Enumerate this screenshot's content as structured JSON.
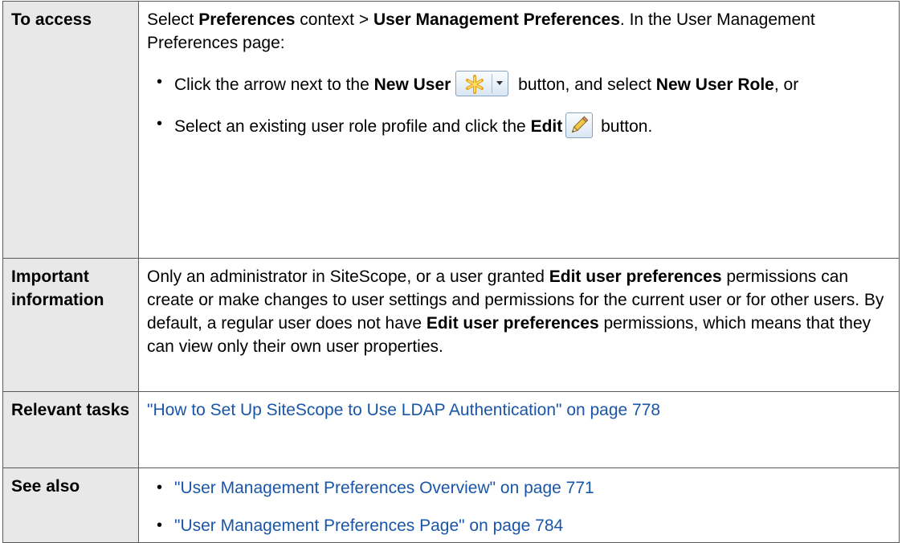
{
  "rows": [
    {
      "header": "To access"
    },
    {
      "header": "Important information"
    },
    {
      "header": "Relevant tasks"
    },
    {
      "header": "See also"
    }
  ],
  "access": {
    "intro": {
      "t1": "Select ",
      "b1": "Preferences",
      "t2": " context > ",
      "b2": "User Management Preferences",
      "t3": ". In the User Management Preferences page:"
    },
    "bullet1": {
      "t1": "Click the arrow next to the ",
      "b1": "New User",
      "t2": " button, and select ",
      "b2": "New User Role",
      "t3": ", or"
    },
    "bullet2": {
      "t1": "Select an existing user role profile and click the ",
      "b1": "Edit",
      "t2": " button."
    }
  },
  "info": {
    "t1": "Only an administrator in SiteScope, or a user granted ",
    "b1": "Edit user preferences",
    "t2": " permissions can create or make changes to user settings and permissions for the current user or for other users. By default, a regular user does not have ",
    "b2": "Edit user preferences",
    "t3": " permissions, which means that they can view only their own user properties."
  },
  "tasks": {
    "link": "\"How to Set Up SiteScope to Use LDAP Authentication\" on page 778"
  },
  "see_also": [
    {
      "link": "\"User Management Preferences Overview\" on page 771"
    },
    {
      "link": "\"User Management Preferences Page\" on page 784"
    }
  ],
  "icons": {
    "new_user": "asterisk-star-icon",
    "dropdown": "caret-down-icon",
    "edit": "pencil-icon"
  },
  "colors": {
    "link": "#1a56a8",
    "header_bg": "#e8e8e8",
    "border": "#5a5a5a"
  }
}
